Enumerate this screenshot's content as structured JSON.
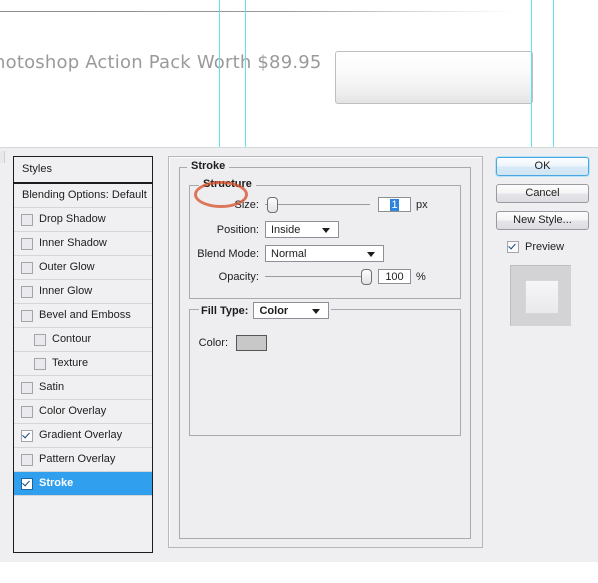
{
  "canvas": {
    "promo_text": "hotoshop Action Pack Worth $89.95",
    "guides": [
      "guide-1",
      "guide-2",
      "guide-3",
      "guide-4"
    ],
    "button_shape": "rounded-rectangle-gradient"
  },
  "dialog": {
    "styles_panel": {
      "header": "Styles",
      "blending_options": "Blending Options: Default",
      "items": [
        {
          "label": "Drop Shadow",
          "checked": false,
          "indent": false,
          "selected": false
        },
        {
          "label": "Inner Shadow",
          "checked": false,
          "indent": false,
          "selected": false
        },
        {
          "label": "Outer Glow",
          "checked": false,
          "indent": false,
          "selected": false
        },
        {
          "label": "Inner Glow",
          "checked": false,
          "indent": false,
          "selected": false
        },
        {
          "label": "Bevel and Emboss",
          "checked": false,
          "indent": false,
          "selected": false
        },
        {
          "label": "Contour",
          "checked": false,
          "indent": true,
          "selected": false
        },
        {
          "label": "Texture",
          "checked": false,
          "indent": true,
          "selected": false
        },
        {
          "label": "Satin",
          "checked": false,
          "indent": false,
          "selected": false
        },
        {
          "label": "Color Overlay",
          "checked": false,
          "indent": false,
          "selected": false
        },
        {
          "label": "Gradient Overlay",
          "checked": true,
          "indent": false,
          "selected": false
        },
        {
          "label": "Pattern Overlay",
          "checked": false,
          "indent": false,
          "selected": false
        },
        {
          "label": "Stroke",
          "checked": true,
          "indent": false,
          "selected": true
        }
      ]
    },
    "main_panel": {
      "group_title": "Stroke",
      "structure": {
        "title": "Structure",
        "size_label": "Size:",
        "size_value": "1",
        "size_unit": "px",
        "size_slider_percent": 2,
        "position_label": "Position:",
        "position_value": "Inside",
        "blend_mode_label": "Blend Mode:",
        "blend_mode_value": "Normal",
        "opacity_label": "Opacity:",
        "opacity_value": "100",
        "opacity_unit": "%",
        "opacity_slider_percent": 100
      },
      "fill": {
        "fill_type_label": "Fill Type:",
        "fill_type_value": "Color",
        "color_label": "Color:",
        "color_swatch": "#c8c8c8"
      }
    },
    "buttons": {
      "ok": "OK",
      "cancel": "Cancel",
      "new_style": "New Style...",
      "preview": "Preview",
      "preview_checked": true
    }
  },
  "colors": {
    "guide": "#5fe0ef",
    "selection_blue": "#2f9fee",
    "annotation": "#d64e28",
    "dialog_bg": "#efeff2"
  }
}
